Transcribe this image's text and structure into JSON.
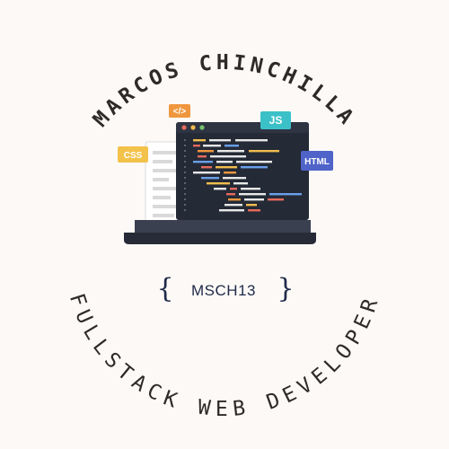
{
  "logo": {
    "name": "MARCOS CHINCHILLA",
    "role": "FULLSTACK WEB DEVELOPER",
    "handle": "MSCH13",
    "brace_open": "{",
    "brace_close": "}",
    "badges": {
      "js": "JS",
      "css": "CSS",
      "html": "HTML",
      "tag": "</>"
    },
    "colors": {
      "background": "#fcf9f6",
      "text": "#2e2a28",
      "handle": "#1f2a4a",
      "screen": "#242a36",
      "laptop_base": "#262b37",
      "badge_js": "#3bc0c8",
      "badge_css": "#f2c24a",
      "badge_html": "#4f63c9",
      "badge_tag": "#f0973e"
    }
  }
}
